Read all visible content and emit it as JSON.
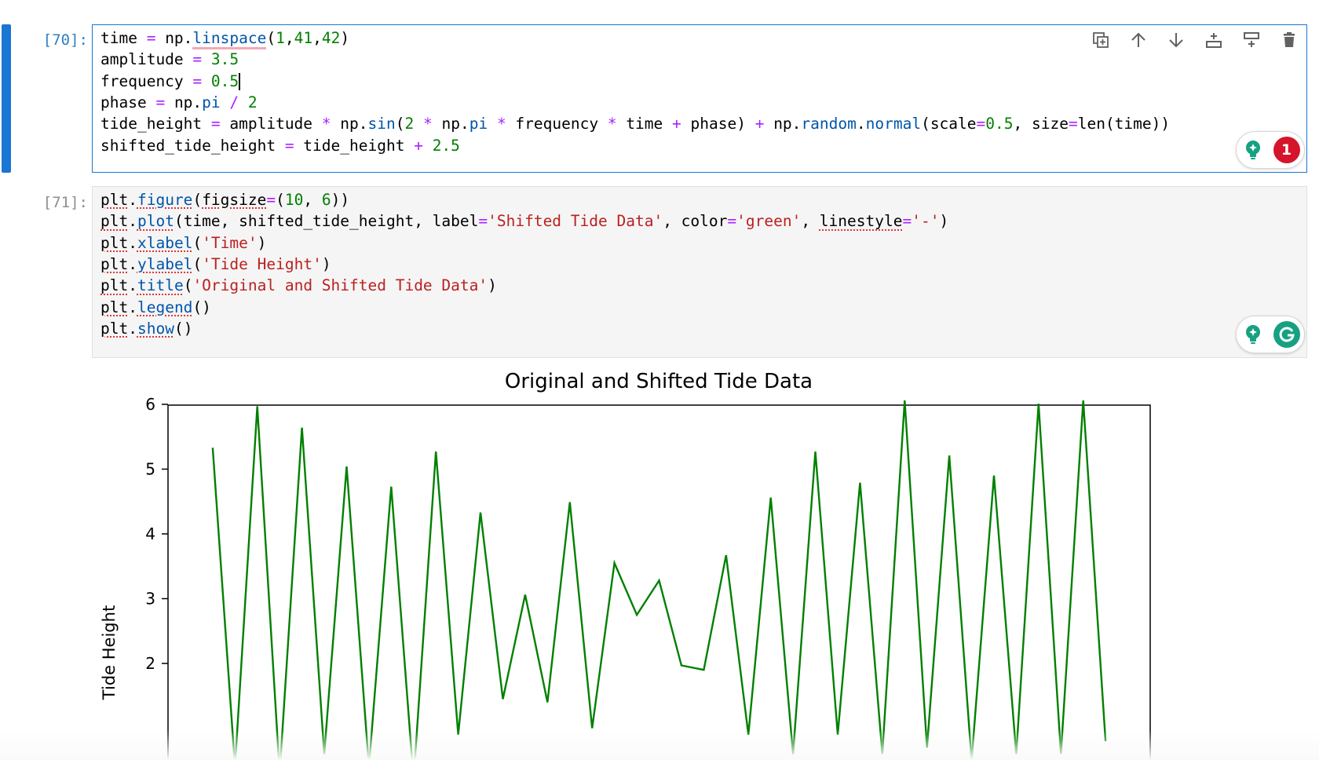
{
  "cells": [
    {
      "prompt": "[70]:",
      "lines": [
        [
          [
            "time ",
            "plain"
          ],
          [
            "=",
            "op"
          ],
          [
            " np.",
            "plain"
          ],
          [
            "linspace",
            "attr-pink"
          ],
          [
            "(",
            "plain"
          ],
          [
            "1",
            "num"
          ],
          [
            ",",
            "plain"
          ],
          [
            "41",
            "num"
          ],
          [
            ",",
            "plain"
          ],
          [
            "42",
            "num"
          ],
          [
            ")",
            "plain"
          ]
        ],
        [
          [
            "amplitude ",
            "plain"
          ],
          [
            "=",
            "op"
          ],
          [
            " ",
            "plain"
          ],
          [
            "3.5",
            "num"
          ]
        ],
        [
          [
            "frequency ",
            "plain"
          ],
          [
            "=",
            "op"
          ],
          [
            " ",
            "plain"
          ],
          [
            "0.5",
            "num"
          ],
          [
            "",
            "cursor"
          ]
        ],
        [
          [
            "phase ",
            "plain"
          ],
          [
            "=",
            "op"
          ],
          [
            " np.",
            "plain"
          ],
          [
            "pi",
            "attr"
          ],
          [
            " ",
            "plain"
          ],
          [
            "/",
            "op"
          ],
          [
            " ",
            "plain"
          ],
          [
            "2",
            "num"
          ]
        ],
        [
          [
            "tide_height ",
            "plain"
          ],
          [
            "=",
            "op"
          ],
          [
            " amplitude ",
            "plain"
          ],
          [
            "*",
            "op"
          ],
          [
            " np.",
            "plain"
          ],
          [
            "sin",
            "attr"
          ],
          [
            "(",
            "plain"
          ],
          [
            "2",
            "num"
          ],
          [
            " ",
            "plain"
          ],
          [
            "*",
            "op"
          ],
          [
            " np.",
            "plain"
          ],
          [
            "pi",
            "attr"
          ],
          [
            " ",
            "plain"
          ],
          [
            "*",
            "op"
          ],
          [
            " frequency ",
            "plain"
          ],
          [
            "*",
            "op"
          ],
          [
            " time ",
            "plain"
          ],
          [
            "+",
            "op"
          ],
          [
            " phase) ",
            "plain"
          ],
          [
            "+",
            "op"
          ],
          [
            " np.",
            "plain"
          ],
          [
            "random",
            "attr"
          ],
          [
            ".",
            "plain"
          ],
          [
            "normal",
            "attr"
          ],
          [
            "(scale",
            "plain"
          ],
          [
            "=",
            "op"
          ],
          [
            "0.5",
            "num"
          ],
          [
            ", size",
            "plain"
          ],
          [
            "=",
            "op"
          ],
          [
            "len(time))",
            "plain"
          ]
        ],
        [
          [
            "shifted_tide_height ",
            "plain"
          ],
          [
            "=",
            "op"
          ],
          [
            " tide_height ",
            "plain"
          ],
          [
            "+",
            "op"
          ],
          [
            " ",
            "plain"
          ],
          [
            "2.5",
            "num"
          ]
        ]
      ]
    },
    {
      "prompt": "[71]:",
      "lines": [
        [
          [
            "plt",
            "sq-plain"
          ],
          [
            ".",
            "plain"
          ],
          [
            "figure",
            "sq-attr"
          ],
          [
            "(",
            "plain"
          ],
          [
            "figsize",
            "sq-plain"
          ],
          [
            "=",
            "op"
          ],
          [
            "(",
            "plain"
          ],
          [
            "10",
            "num"
          ],
          [
            ", ",
            "plain"
          ],
          [
            "6",
            "num"
          ],
          [
            "))",
            "plain"
          ]
        ],
        [
          [
            "plt",
            "sq-plain"
          ],
          [
            ".",
            "plain"
          ],
          [
            "plot",
            "sq-attr"
          ],
          [
            "(time, shifted_tide_height, label",
            "plain"
          ],
          [
            "=",
            "op"
          ],
          [
            "'Shifted Tide Data'",
            "str"
          ],
          [
            ", color",
            "plain"
          ],
          [
            "=",
            "op"
          ],
          [
            "'green'",
            "str"
          ],
          [
            ", ",
            "plain"
          ],
          [
            "linestyle",
            "sq-plain"
          ],
          [
            "=",
            "op"
          ],
          [
            "'-'",
            "str"
          ],
          [
            ")",
            "plain"
          ]
        ],
        [
          [
            "plt",
            "sq-plain"
          ],
          [
            ".",
            "plain"
          ],
          [
            "xlabel",
            "sq-attr"
          ],
          [
            "(",
            "plain"
          ],
          [
            "'Time'",
            "str"
          ],
          [
            ")",
            "plain"
          ]
        ],
        [
          [
            "plt",
            "sq-plain"
          ],
          [
            ".",
            "plain"
          ],
          [
            "ylabel",
            "sq-attr"
          ],
          [
            "(",
            "plain"
          ],
          [
            "'Tide Height'",
            "str"
          ],
          [
            ")",
            "plain"
          ]
        ],
        [
          [
            "plt",
            "sq-plain"
          ],
          [
            ".",
            "plain"
          ],
          [
            "title",
            "sq-attr"
          ],
          [
            "(",
            "plain"
          ],
          [
            "'Original and Shifted Tide Data'",
            "str"
          ],
          [
            ")",
            "plain"
          ]
        ],
        [
          [
            "plt",
            "sq-plain"
          ],
          [
            ".",
            "plain"
          ],
          [
            "legend",
            "sq-attr"
          ],
          [
            "()",
            "plain"
          ]
        ],
        [
          [
            "plt",
            "sq-plain"
          ],
          [
            ".",
            "plain"
          ],
          [
            "show",
            "sq-attr"
          ],
          [
            "()",
            "plain"
          ]
        ]
      ]
    }
  ],
  "toolbar": {
    "icons": [
      "duplicate-icon",
      "move-up-icon",
      "move-down-icon",
      "insert-above-icon",
      "insert-below-icon",
      "delete-icon"
    ]
  },
  "grammarly": {
    "issue_count": "1"
  },
  "colors": {
    "accent": "#1976d2",
    "line": "#008000",
    "badge": "#d5152b",
    "grammarly": "#15a182"
  },
  "chart_data": {
    "type": "line",
    "title": "Original and Shifted Tide Data",
    "xlabel": "",
    "ylabel": "Tide Height",
    "yticks": [
      "2",
      "3",
      "4",
      "5",
      "6"
    ],
    "series": [
      {
        "color": "#008000",
        "x": [
          1,
          2,
          3,
          4,
          5,
          6,
          7,
          8,
          9,
          10,
          11,
          12,
          13,
          14,
          15,
          16,
          17,
          18,
          19,
          20,
          21,
          22,
          23,
          24,
          25,
          26,
          27,
          28,
          29,
          30,
          31,
          32,
          33,
          34,
          35,
          36,
          37,
          38,
          39,
          40,
          41
        ],
        "y": [
          5.33,
          0.4,
          5.97,
          0.3,
          5.64,
          0.6,
          5.04,
          0.4,
          4.73,
          0.2,
          5.27,
          0.9,
          4.33,
          1.45,
          3.06,
          1.4,
          4.49,
          1.0,
          3.55,
          2.75,
          3.28,
          1.97,
          1.9,
          3.67,
          0.9,
          4.56,
          0.6,
          5.27,
          0.9,
          4.79,
          0.6,
          6.06,
          0.7,
          5.21,
          0.5,
          4.9,
          0.6,
          6.01,
          0.6,
          6.06,
          0.8
        ]
      }
    ]
  }
}
